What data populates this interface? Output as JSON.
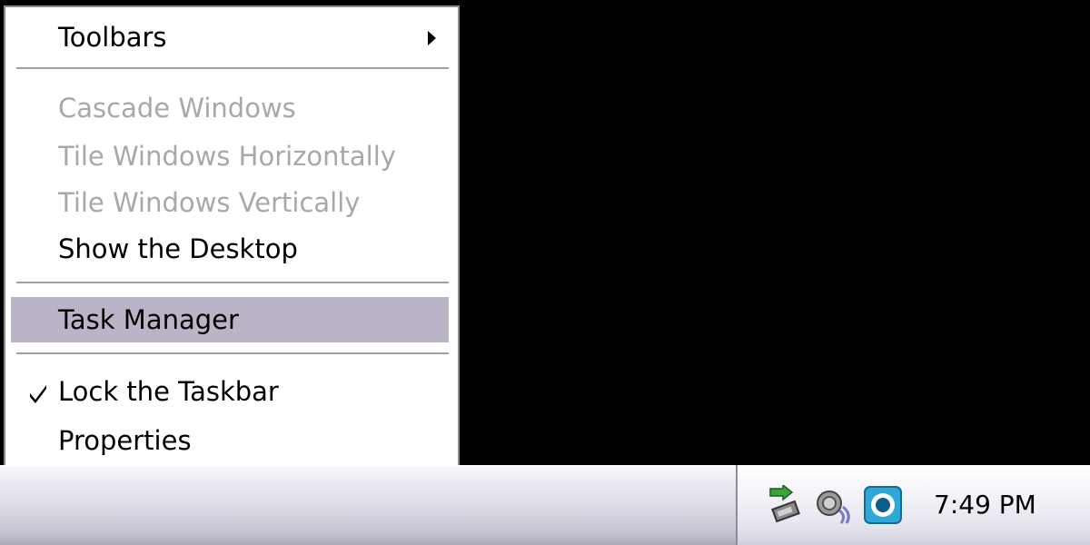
{
  "context_menu": {
    "toolbars": {
      "label": "Toolbars",
      "submenu": true
    },
    "cascade_windows": {
      "label": "Cascade Windows",
      "enabled": false
    },
    "tile_horizontally": {
      "label": "Tile Windows Horizontally",
      "enabled": false
    },
    "tile_vertically": {
      "label": "Tile Windows Vertically",
      "enabled": false
    },
    "show_desktop": {
      "label": "Show the Desktop",
      "enabled": true
    },
    "task_manager": {
      "label": "Task Manager",
      "highlighted": true
    },
    "lock_taskbar": {
      "label": "Lock the Taskbar",
      "checked": true
    },
    "properties": {
      "label": "Properties"
    }
  },
  "tray": {
    "icons": [
      "safely-remove-hardware-icon",
      "volume-icon",
      "blue-circle-app-icon"
    ],
    "clock": "7:49 PM"
  },
  "colors": {
    "highlight": "#bab4c6",
    "disabled_text": "#a8a8a8",
    "desktop": "#000000"
  }
}
